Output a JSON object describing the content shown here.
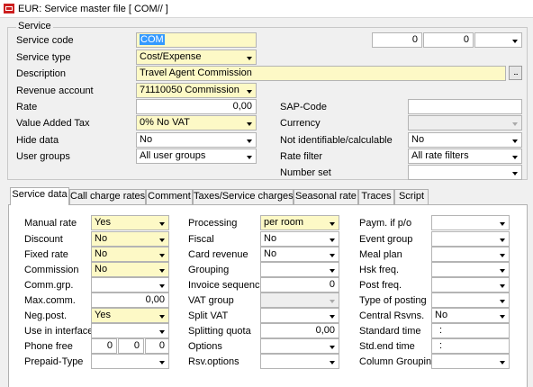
{
  "window": {
    "title": "EUR: Service master file [ COM// ]"
  },
  "group": {
    "label": "Service"
  },
  "left_fields": {
    "service_code": {
      "label": "Service code",
      "value": "COM"
    },
    "service_type": {
      "label": "Service type",
      "value": "Cost/Expense"
    },
    "description": {
      "label": "Description",
      "value": "Travel Agent Commission"
    },
    "revenue_account": {
      "label": "Revenue account",
      "value": "71110050  Commission"
    },
    "rate": {
      "label": "Rate",
      "value": "0,00"
    },
    "vat": {
      "label": "Value Added Tax",
      "value": "0% No VAT"
    },
    "hide_data": {
      "label": "Hide data",
      "value": "No"
    },
    "user_groups": {
      "label": "User groups",
      "value": "All user groups"
    }
  },
  "top_right": {
    "num1": "0",
    "num2": "0",
    "dropdown": ""
  },
  "ellipsis_label": "...",
  "right_fields": {
    "sap_code": {
      "label": "SAP-Code",
      "value": ""
    },
    "currency": {
      "label": "Currency",
      "value": ""
    },
    "not_identifiable": {
      "label": "Not identifiable/calculable",
      "value": "No"
    },
    "rate_filter": {
      "label": "Rate filter",
      "value": "All rate filters"
    },
    "number_set": {
      "label": "Number set",
      "value": ""
    }
  },
  "tabs": [
    "Service data",
    "Call charge rates",
    "Comment",
    "Taxes/Service charges",
    "Seasonal rate",
    "Traces",
    "Script"
  ],
  "col1": {
    "manual_rate": {
      "label": "Manual rate",
      "value": "Yes"
    },
    "discount": {
      "label": "Discount",
      "value": "No"
    },
    "fixed_rate": {
      "label": "Fixed rate",
      "value": "No"
    },
    "commission": {
      "label": "Commission",
      "value": "No"
    },
    "comm_grp": {
      "label": "Comm.grp.",
      "value": ""
    },
    "max_comm": {
      "label": "Max.comm.",
      "value": "0,00"
    },
    "neg_post": {
      "label": "Neg.post.",
      "value": "Yes"
    },
    "use_in_interface": {
      "label": "Use in interface",
      "value": ""
    },
    "phone_free": {
      "label": "Phone free",
      "v1": "0",
      "v2": "0",
      "v3": "0"
    },
    "prepaid_type": {
      "label": "Prepaid-Type",
      "value": ""
    }
  },
  "col2": {
    "processing": {
      "label": "Processing",
      "value": "per room"
    },
    "fiscal": {
      "label": "Fiscal",
      "value": "No"
    },
    "card_revenue": {
      "label": "Card revenue",
      "value": "No"
    },
    "grouping": {
      "label": "Grouping",
      "value": ""
    },
    "invoice_sequence": {
      "label": "Invoice sequence",
      "value": "0"
    },
    "vat_group": {
      "label": "VAT group",
      "value": ""
    },
    "split_vat": {
      "label": "Split VAT",
      "value": ""
    },
    "splitting_quota": {
      "label": "Splitting quota",
      "value": "0,00"
    },
    "options": {
      "label": "Options",
      "value": ""
    },
    "rsv_options": {
      "label": "Rsv.options",
      "value": ""
    }
  },
  "col3": {
    "paym_pfo": {
      "label": "Paym. if p/o",
      "value": ""
    },
    "event_group": {
      "label": "Event group",
      "value": ""
    },
    "meal_plan": {
      "label": "Meal plan",
      "value": ""
    },
    "hsk_freq": {
      "label": "Hsk freq.",
      "value": ""
    },
    "post_freq": {
      "label": "Post freq.",
      "value": ""
    },
    "type_of_posting": {
      "label": "Type of posting",
      "value": ""
    },
    "central_rsvns": {
      "label": "Central Rsvns.",
      "value": "No"
    },
    "standard_time": {
      "label": "Standard time",
      "value": ":"
    },
    "std_end_time": {
      "label": "Std.end time",
      "value": ":"
    },
    "column_grouping": {
      "label": "Column Grouping",
      "value": ""
    }
  },
  "colors": {
    "required_field": "#fdf9c6",
    "selection": "#3399ff",
    "app_icon": "#cc1f1f"
  },
  "icons": {
    "app": "app-icon",
    "dropdown": "chevron-down-icon"
  }
}
